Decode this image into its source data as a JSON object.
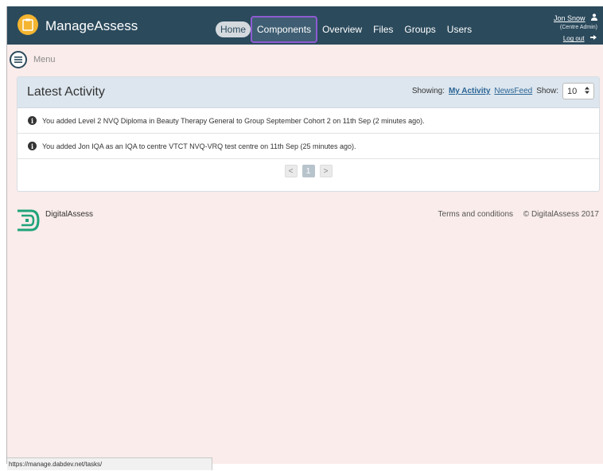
{
  "app": {
    "brand": "ManageAssess"
  },
  "nav": {
    "items": [
      {
        "label": "Home"
      },
      {
        "label": "Components"
      },
      {
        "label": "Overview"
      },
      {
        "label": "Files"
      },
      {
        "label": "Groups"
      },
      {
        "label": "Users"
      }
    ]
  },
  "user": {
    "name": "Jon Snow",
    "role": "(Centre Admin)",
    "logout": "Log out"
  },
  "menu": {
    "label": "Menu"
  },
  "activity": {
    "title": "Latest Activity",
    "showing_label": "Showing:",
    "my_activity": "My Activity",
    "newsfeed": "NewsFeed",
    "show_label": "Show:",
    "show_value": "10",
    "rows": [
      "You added Level 2 NVQ Diploma in Beauty Therapy General to Group September Cohort 2 on 11th Sep (2 minutes ago).",
      "You added Jon IQA as an IQA to centre VTCT NVQ-VRQ test centre on 11th Sep (25 minutes ago)."
    ],
    "pager": {
      "prev": "<",
      "page": "1",
      "next": ">"
    }
  },
  "footer": {
    "brand": "DigitalAssess",
    "terms": "Terms and conditions",
    "copyright": "© DigitalAssess 2017"
  },
  "status": {
    "url": "https://manage.dabdev.net/tasks/"
  },
  "colors": {
    "navbar": "#2b4a5c",
    "accent": "#f4b530",
    "page_bg": "#f9ecea",
    "panel_head": "#dde6ee",
    "footer_logo": "#1fa37a",
    "hover_outline": "#8e5bd1"
  },
  "icons": {
    "logo": "clipboard-icon",
    "user": "user-icon",
    "logout": "logout-icon",
    "menu": "hamburger-icon",
    "info": "info-icon",
    "select": "updown-icon",
    "footer_logo": "digitalassess-logo-icon"
  }
}
